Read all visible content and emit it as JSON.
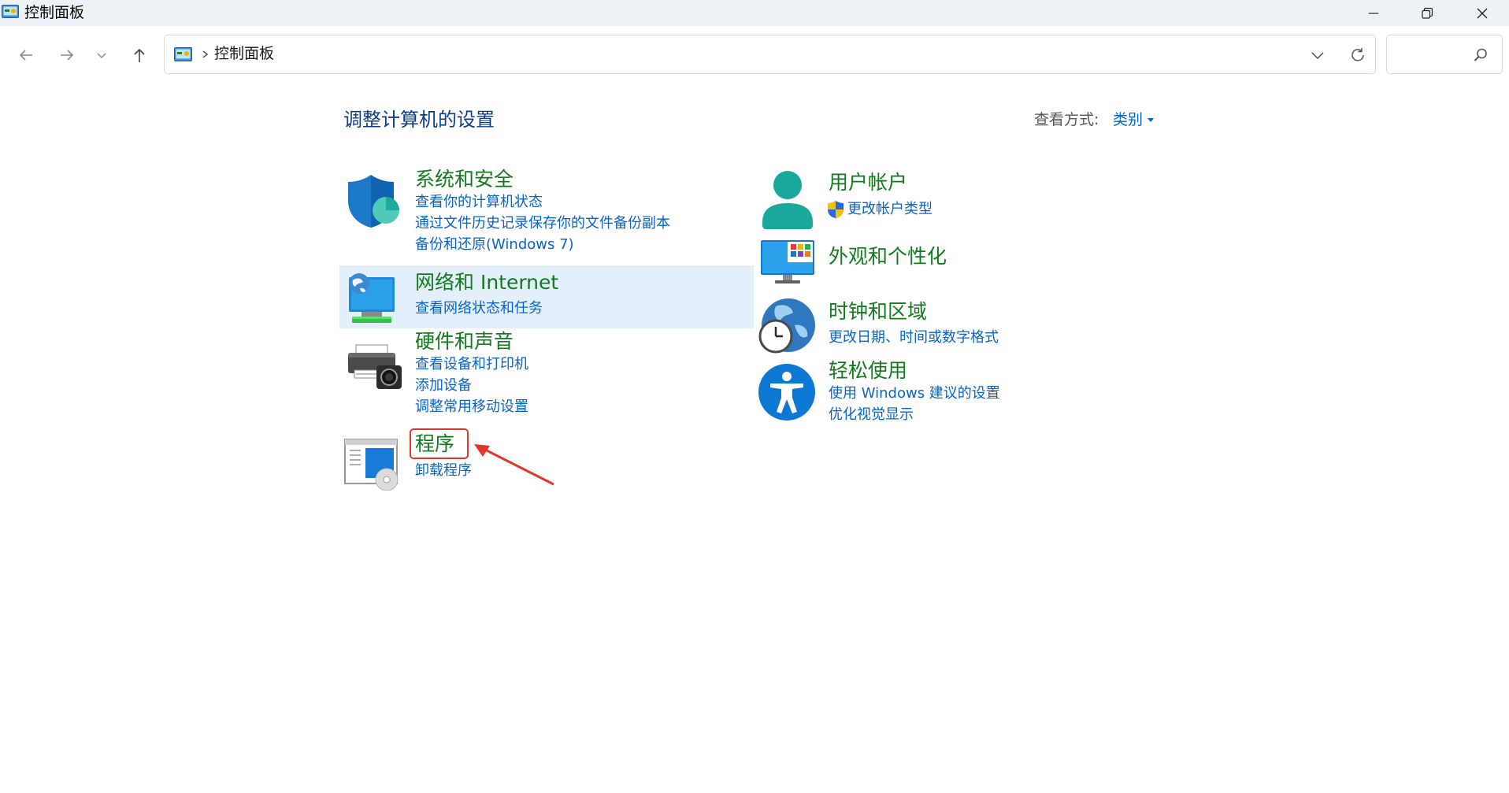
{
  "window": {
    "title": "控制面板",
    "icon": "control-panel-icon"
  },
  "nav": {
    "breadcrumb": "控制面板",
    "search_placeholder": ""
  },
  "header": {
    "title": "调整计算机的设置",
    "view_by_label": "查看方式:",
    "view_by_value": "类别"
  },
  "categories": [
    {
      "title": "系统和安全",
      "icon": "shield-icon",
      "links": [
        "查看你的计算机状态",
        "通过文件历史记录保存你的文件备份副本",
        "备份和还原(Windows 7)"
      ]
    },
    {
      "title": "网络和 Internet",
      "icon": "network-icon",
      "links": [
        "查看网络状态和任务"
      ]
    },
    {
      "title": "硬件和声音",
      "icon": "printer-icon",
      "links": [
        "查看设备和打印机",
        "添加设备",
        "调整常用移动设置"
      ]
    },
    {
      "title": "程序",
      "icon": "programs-icon",
      "links": [
        "卸载程序"
      ]
    },
    {
      "title": "用户帐户",
      "icon": "user-icon",
      "links": [
        "更改帐户类型"
      ]
    },
    {
      "title": "外观和个性化",
      "icon": "monitor-icon",
      "links": []
    },
    {
      "title": "时钟和区域",
      "icon": "clock-globe-icon",
      "links": [
        "更改日期、时间或数字格式"
      ]
    },
    {
      "title": "轻松使用",
      "icon": "accessibility-icon",
      "links": [
        "使用 Windows 建议的设置",
        "优化视觉显示"
      ]
    }
  ],
  "colors": {
    "title_green": "#127a1e",
    "link_blue": "#0a64c8",
    "header_blue": "#0e3c8a",
    "annotation_red": "#e0362a",
    "hover_bg": "#e3f0fb"
  }
}
